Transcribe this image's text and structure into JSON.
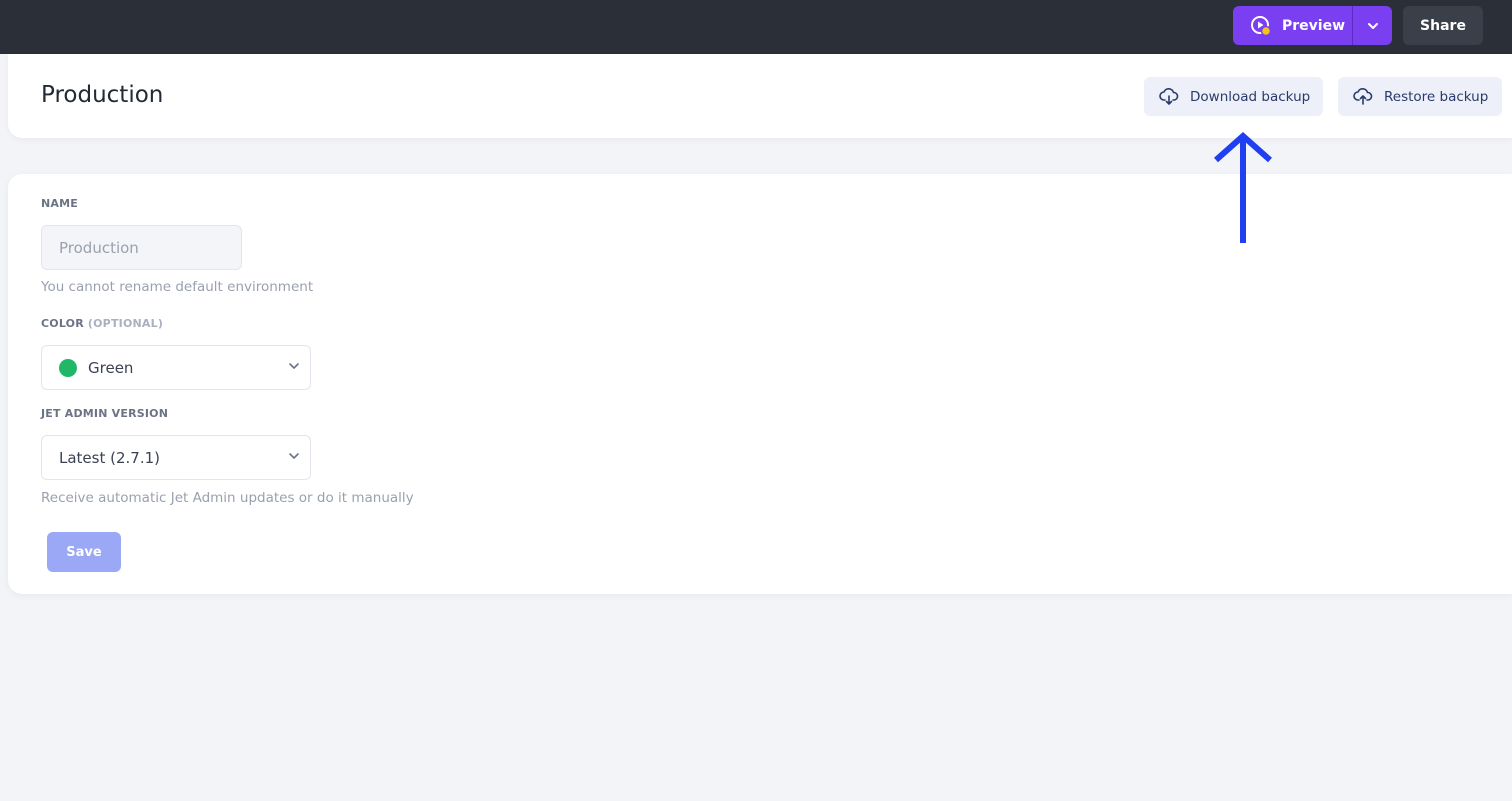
{
  "topbar": {
    "preview_label": "Preview",
    "share_label": "Share",
    "preview_color": "#7a3ff0",
    "preview_badge_color": "#f7c21d"
  },
  "header": {
    "title": "Production",
    "download_label": "Download backup",
    "restore_label": "Restore backup"
  },
  "form": {
    "name_label": "NAME",
    "name_value": "Production",
    "name_hint": "You cannot rename default environment",
    "color_label": "COLOR",
    "color_optional": "(OPTIONAL)",
    "color_value": "Green",
    "color_swatch": "#20b866",
    "version_label": "JET ADMIN VERSION",
    "version_value": "Latest (2.7.1)",
    "version_hint": "Receive automatic Jet Admin updates or do it manually",
    "save_label": "Save"
  },
  "annotation": {
    "arrow_color": "#1f3ff0",
    "arrow_icon": "arrow-up-icon"
  }
}
